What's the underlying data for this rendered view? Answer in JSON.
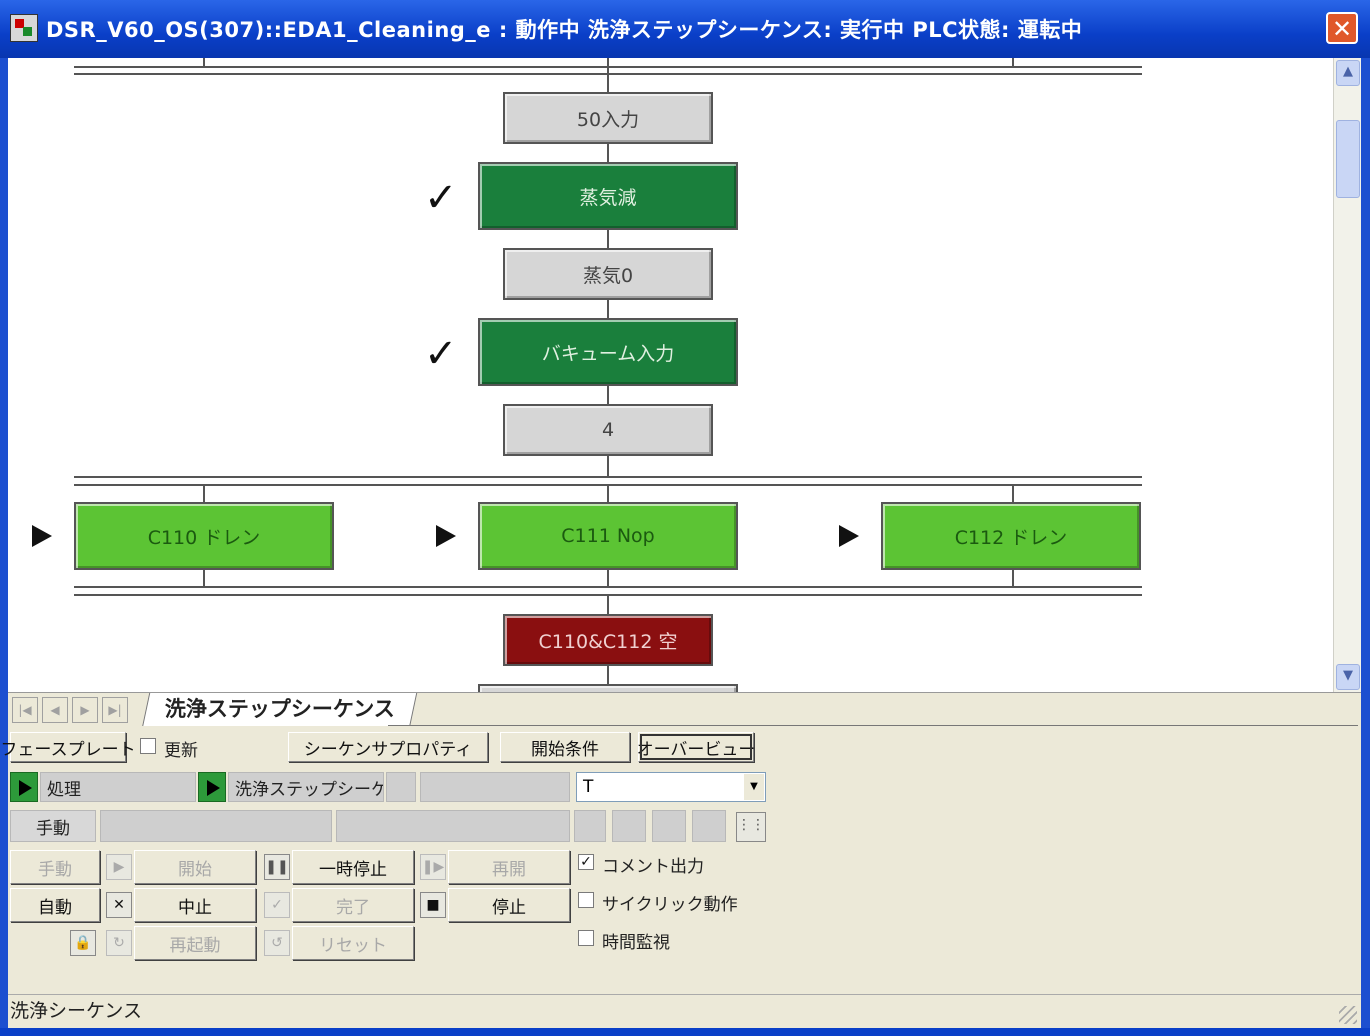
{
  "window": {
    "title": "DSR_V60_OS(307)::EDA1_Cleaning_e : 動作中 洗浄ステップシーケンス: 実行中      PLC状態: 運転中",
    "close_symbol": "✕"
  },
  "sequence": {
    "steps": [
      {
        "label": "50入力",
        "style": "gray"
      },
      {
        "label": "蒸気減",
        "style": "dark-green",
        "checked": true
      },
      {
        "label": "蒸気0",
        "style": "gray"
      },
      {
        "label": "バキューム入力",
        "style": "dark-green",
        "checked": true
      },
      {
        "label": "4",
        "style": "gray"
      },
      {
        "label": "C110 ドレン",
        "style": "light-green",
        "active": true
      },
      {
        "label": "C111 Nop",
        "style": "light-green",
        "active": true
      },
      {
        "label": "C112 ドレン",
        "style": "light-green",
        "active": true
      },
      {
        "label": "C110&C112 空",
        "style": "red"
      }
    ],
    "check_mark": "✓"
  },
  "tabs": {
    "nav": [
      "|◀",
      "◀",
      "▶",
      "▶|"
    ],
    "active_label": "洗浄ステップシーケンス"
  },
  "toolbar": {
    "phase_plate": "フェースプレート",
    "update_label": "更新",
    "sequence_properties": "シーケンサプロパティ",
    "start_conditions": "開始条件",
    "overview": "オーバービュー"
  },
  "status_row": {
    "process_label": "処理",
    "sequence_label": "洗浄ステップシーケン",
    "combo_value": "T",
    "manual_field": "手動"
  },
  "buttons": {
    "manual": "手動",
    "auto": "自動",
    "start": "開始",
    "pause": "一時停止",
    "resume": "再開",
    "abort": "中止",
    "complete": "完了",
    "stop": "停止",
    "restart": "再起動",
    "reset": "リセット"
  },
  "options": {
    "comment_output": {
      "label": "コメント出力",
      "checked": true
    },
    "cyclic": {
      "label": "サイクリック動作",
      "checked": false
    },
    "time_monitor": {
      "label": "時間監視",
      "checked": false
    }
  },
  "statusbar": {
    "text": "洗浄シーケンス"
  },
  "colors": {
    "dark_green": "#1a7f3c",
    "light_green": "#5cc434",
    "red": "#8a0f10",
    "gray": "#d6d6d6"
  }
}
